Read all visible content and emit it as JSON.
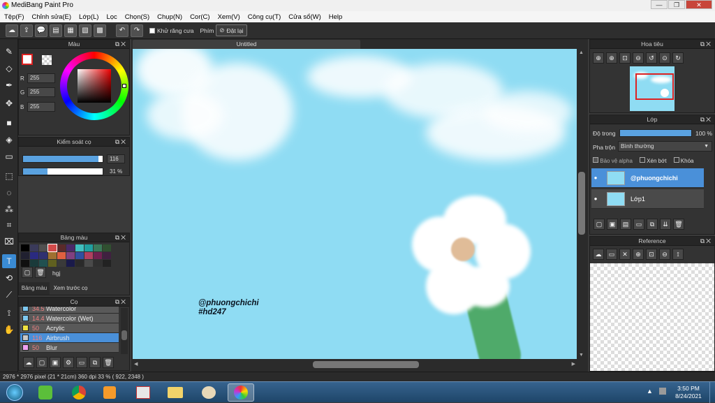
{
  "window": {
    "title": "MediBang Paint Pro"
  },
  "menu": [
    "Tệp(F)",
    "Chỉnh sửa(E)",
    "Lớp(L)",
    "Lọc",
    "Chọn(S)",
    "Chụp(N)",
    "Cor(C)",
    "Xem(V)",
    "Công cụ(T)",
    "Cửa sổ(W)",
    "Help"
  ],
  "toolbar": {
    "antialias_label": "Khử răng cưa",
    "phim_label": "Phím",
    "reset_label": "Đặt lại"
  },
  "color_panel": {
    "title": "Màu",
    "r_label": "R",
    "g_label": "G",
    "b_label": "B",
    "r": "255",
    "g": "255",
    "b": "255"
  },
  "brush_control": {
    "title": "Kiểm soát cọ",
    "size": "116",
    "size_fraction": 0.95,
    "opacity": "31 %",
    "opacity_fraction": 0.31
  },
  "palette_panel": {
    "title": "Bảng màu",
    "name": "hgj",
    "tab_palette": "Bảng màu",
    "tab_preview": "Xem trước cọ",
    "colors": [
      "#000000",
      "#3a3a5a",
      "#505050",
      "#d24a4a",
      "#5a2a2a",
      "#4a2a6a",
      "#40c0c0",
      "#20a0a0",
      "#3a7a5a",
      "#305030",
      "#202030",
      "#2a2a80",
      "#303070",
      "#a07030",
      "#e06040",
      "#804080",
      "#3050a0",
      "#b04060",
      "#702050",
      "#402040",
      "#101010",
      "#1a3a3a",
      "#205050",
      "#606020",
      "#3a3a3a",
      "#1a1a4a",
      "#2a2a2a",
      "#4a4a4a",
      "#303030",
      "#222222"
    ]
  },
  "brush_panel": {
    "title": "Cọ",
    "items": [
      {
        "size": "34.5",
        "name": "Watercolor",
        "color": "#7ec8f0"
      },
      {
        "size": "14.4",
        "name": "Watercolor (Wet)",
        "color": "#7ec8f0"
      },
      {
        "size": "50",
        "name": "Acrylic",
        "color": "#f0e040"
      },
      {
        "size": "116",
        "name": "Airbrush",
        "color": "#c8c8c8"
      },
      {
        "size": "50",
        "name": "Blur",
        "color": "#f0a0f0"
      }
    ]
  },
  "document": {
    "tab": "Untitled",
    "watermark_line1": "@phuongchichi",
    "watermark_line2": "#hd247"
  },
  "navigator": {
    "title": "Hoa tiêu"
  },
  "layer_panel": {
    "title": "Lớp",
    "opacity_label": "Độ trong",
    "opacity_value": "100 %",
    "blend_label": "Pha trộn",
    "blend_value": "Bình thường",
    "protect_alpha": "Bảo vệ alpha",
    "clipping": "Xén bớt",
    "lock": "Khóa",
    "layers": [
      {
        "name": "@phuongchichi",
        "selected": true
      },
      {
        "name": "Lớp1",
        "selected": false
      }
    ]
  },
  "reference_panel": {
    "title": "Reference"
  },
  "status": {
    "size": "2976 * 2976 pixel",
    "cm": "(21 * 21cm)",
    "dpi": "360 dpi",
    "zoom": "33 %",
    "coords": "( 922, 2348 )"
  },
  "taskbar": {
    "time": "3:50 PM",
    "date": "8/24/2021"
  }
}
